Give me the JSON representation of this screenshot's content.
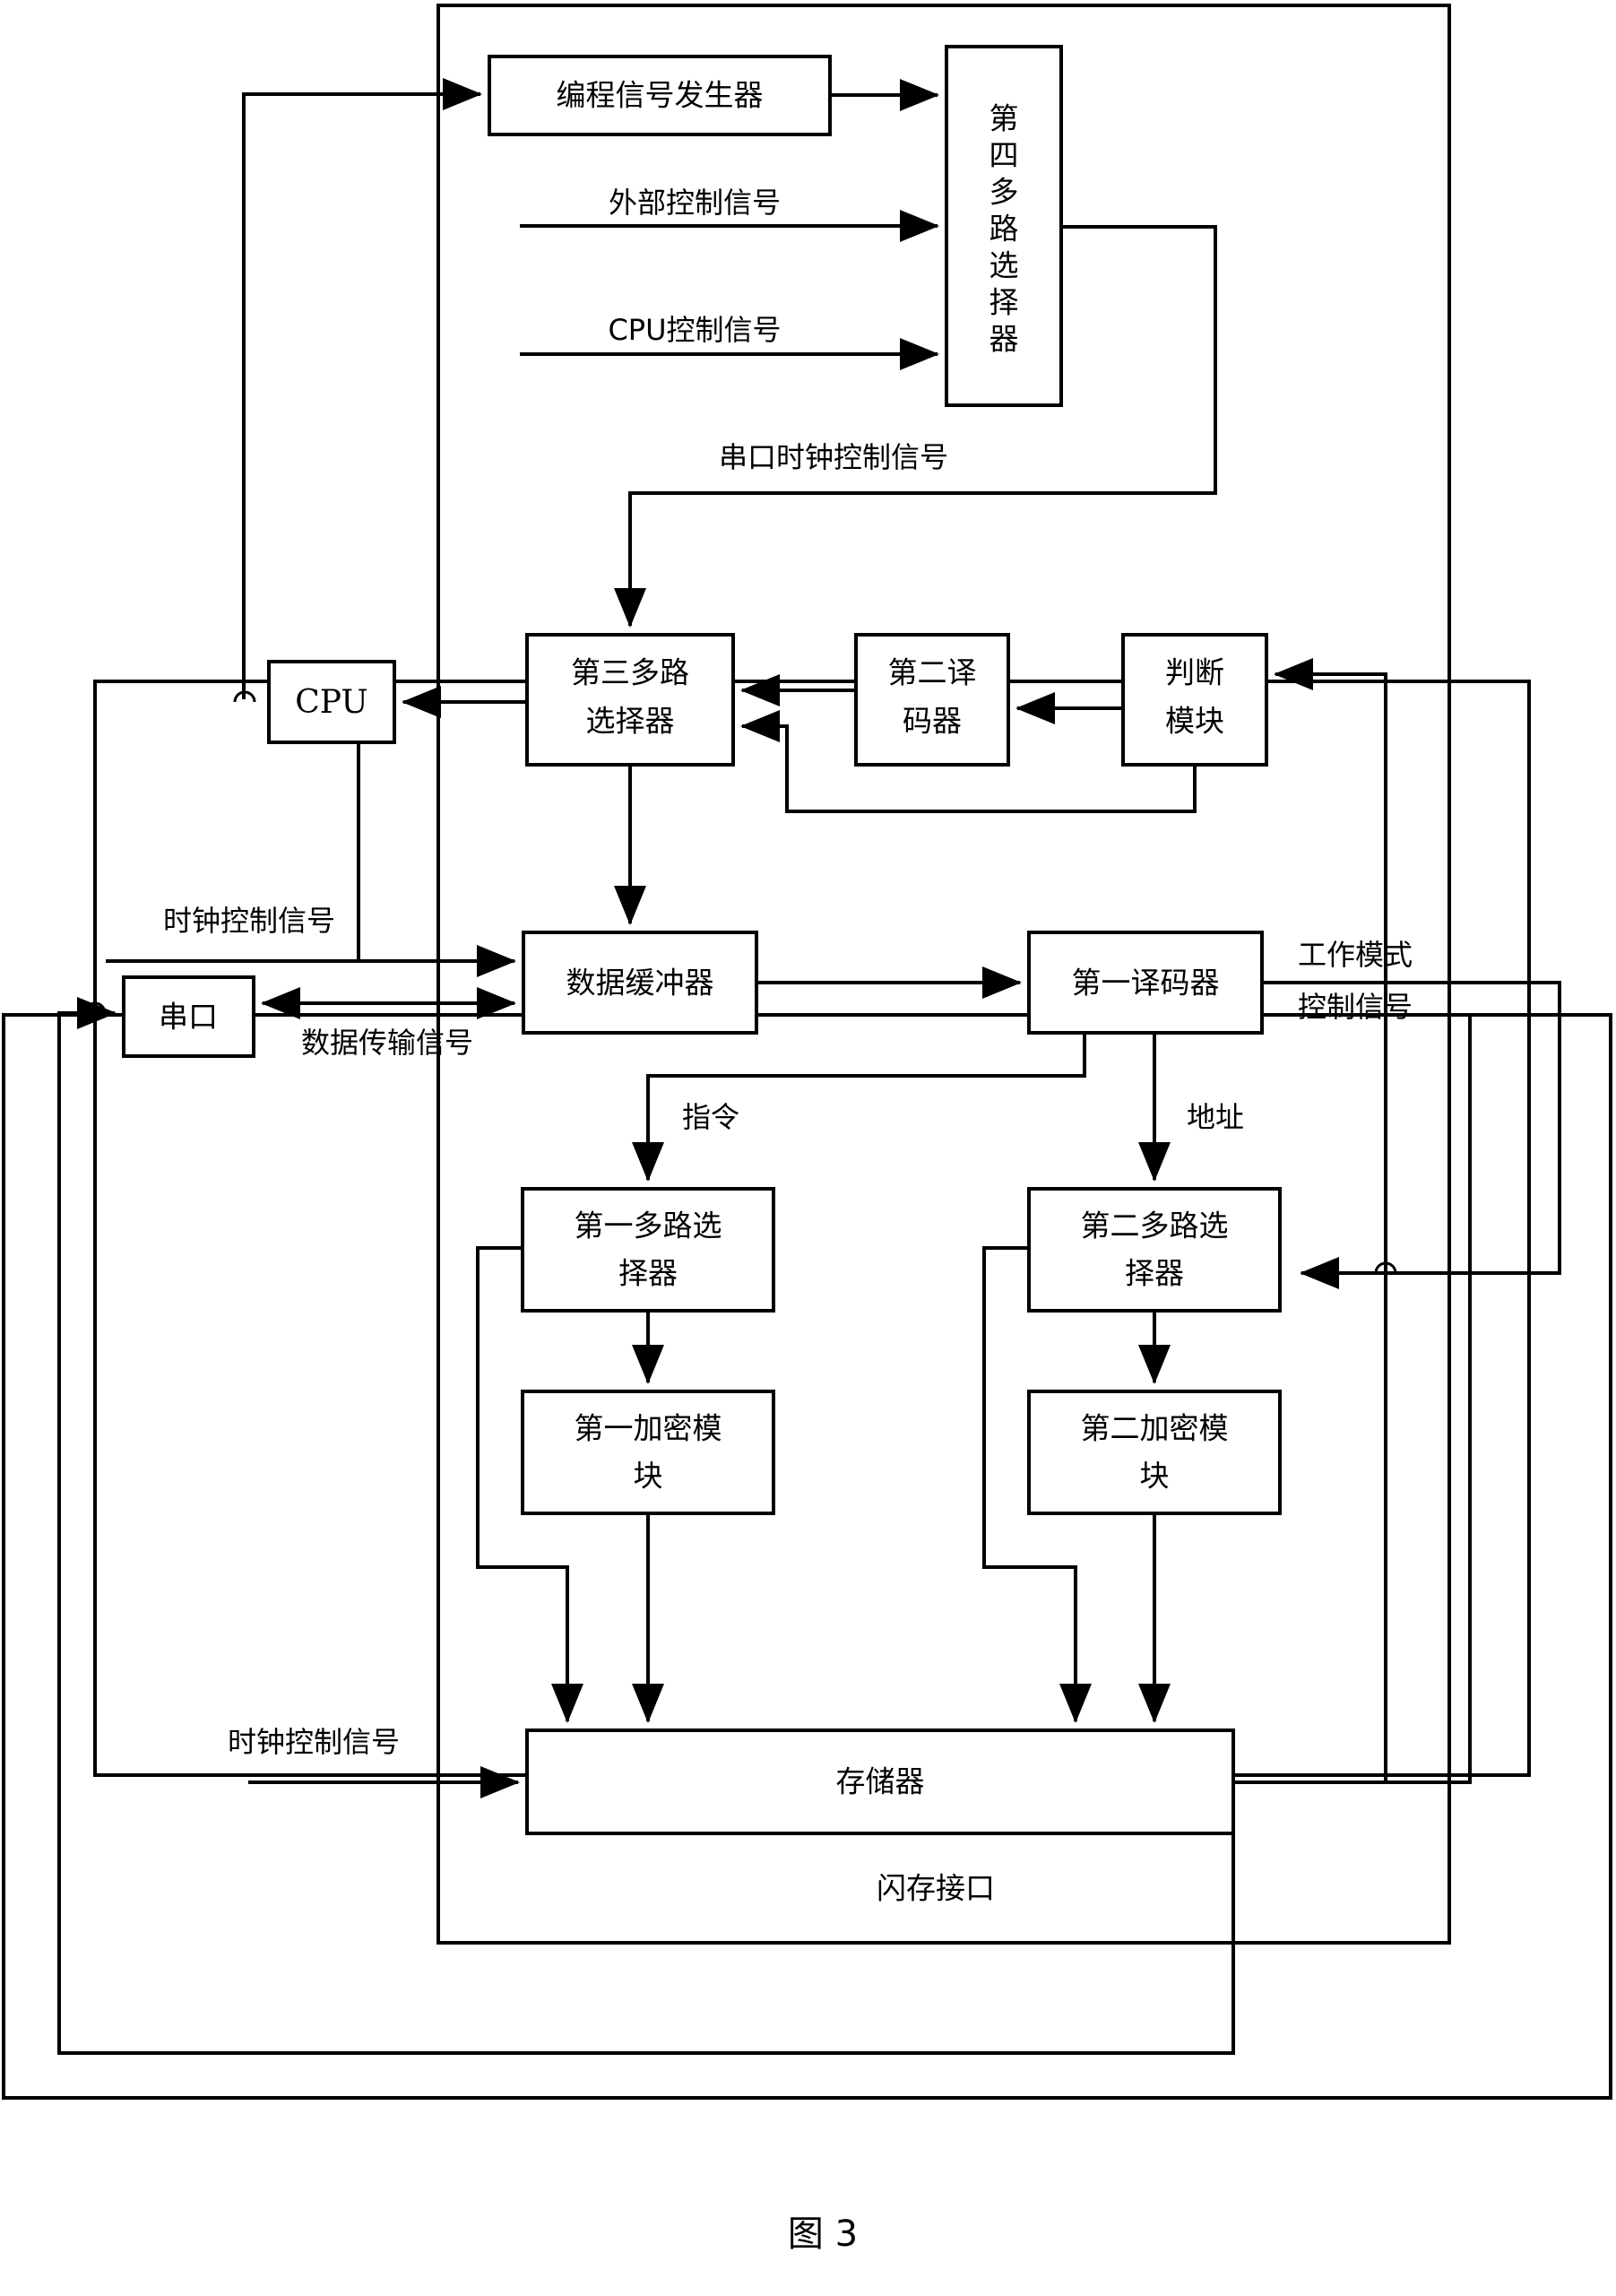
{
  "figure": {
    "caption": "图 3",
    "containers": [
      {
        "name": "outer-frame"
      },
      {
        "name": "middle-frame"
      },
      {
        "name": "flash-interface-frame",
        "label": "闪存接口"
      }
    ]
  },
  "blocks": {
    "program_signal_generator": "编程信号发生器",
    "fourth_mux": "第四多路选择器",
    "cpu": "CPU",
    "third_mux_line1": "第三多路",
    "third_mux_line2": "选择器",
    "second_decoder_line1": "第二译",
    "second_decoder_line2": "码器",
    "judge_module_line1": "判断",
    "judge_module_line2": "模块",
    "serial_port": "串口",
    "data_buffer": "数据缓冲器",
    "first_decoder": "第一译码器",
    "first_mux_line1": "第一多路选",
    "first_mux_line2": "择器",
    "second_mux_line1": "第二多路选",
    "second_mux_line2": "择器",
    "first_crypto_line1": "第一加密模",
    "first_crypto_line2": "块",
    "second_crypto_line1": "第二加密模",
    "second_crypto_line2": "块",
    "memory": "存储器",
    "flash_interface": "闪存接口"
  },
  "signals": {
    "external_control": "外部控制信号",
    "cpu_control": "CPU控制信号",
    "serial_clock_control": "串口时钟控制信号",
    "clock_control_upper": "时钟控制信号",
    "data_transfer": "数据传输信号",
    "work_mode_control_line1": "工作模式",
    "work_mode_control_line2": "控制信号",
    "instruction": "指令",
    "address": "地址",
    "clock_control_lower": "时钟控制信号"
  },
  "colors": {
    "stroke": "#000000",
    "fill": "#ffffff",
    "background": "#ffffff"
  }
}
